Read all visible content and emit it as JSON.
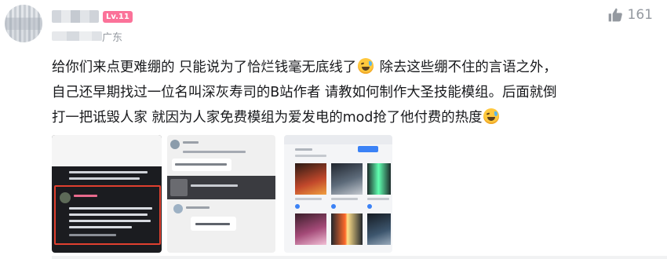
{
  "user": {
    "level": "Lv.11",
    "location": "广东"
  },
  "like": {
    "count": "161",
    "icon": "thumbs-up-icon"
  },
  "comment": {
    "line1a": "给你们来点更难绷的 只能说为了恰烂钱毫无底线了",
    "line1b": " 除去这些绷不住的言语之外，",
    "line2": "自己还早期找过一位名叫深灰寿司的B站作者 请教如何制作大圣技能模组。后面就倒",
    "line3": "打一把诋毁人家 就因为人家免费模组为爱发电的mod抢了他付费的热度"
  },
  "emoji_icon": "laugh-cry-emoji",
  "images": [
    {
      "alt": "dark chat screenshot"
    },
    {
      "alt": "light chat screenshot"
    },
    {
      "alt": "mod store screenshot"
    }
  ],
  "colors": {
    "badge": "#fb7299",
    "meta": "#9499a0",
    "text": "#18191c"
  }
}
